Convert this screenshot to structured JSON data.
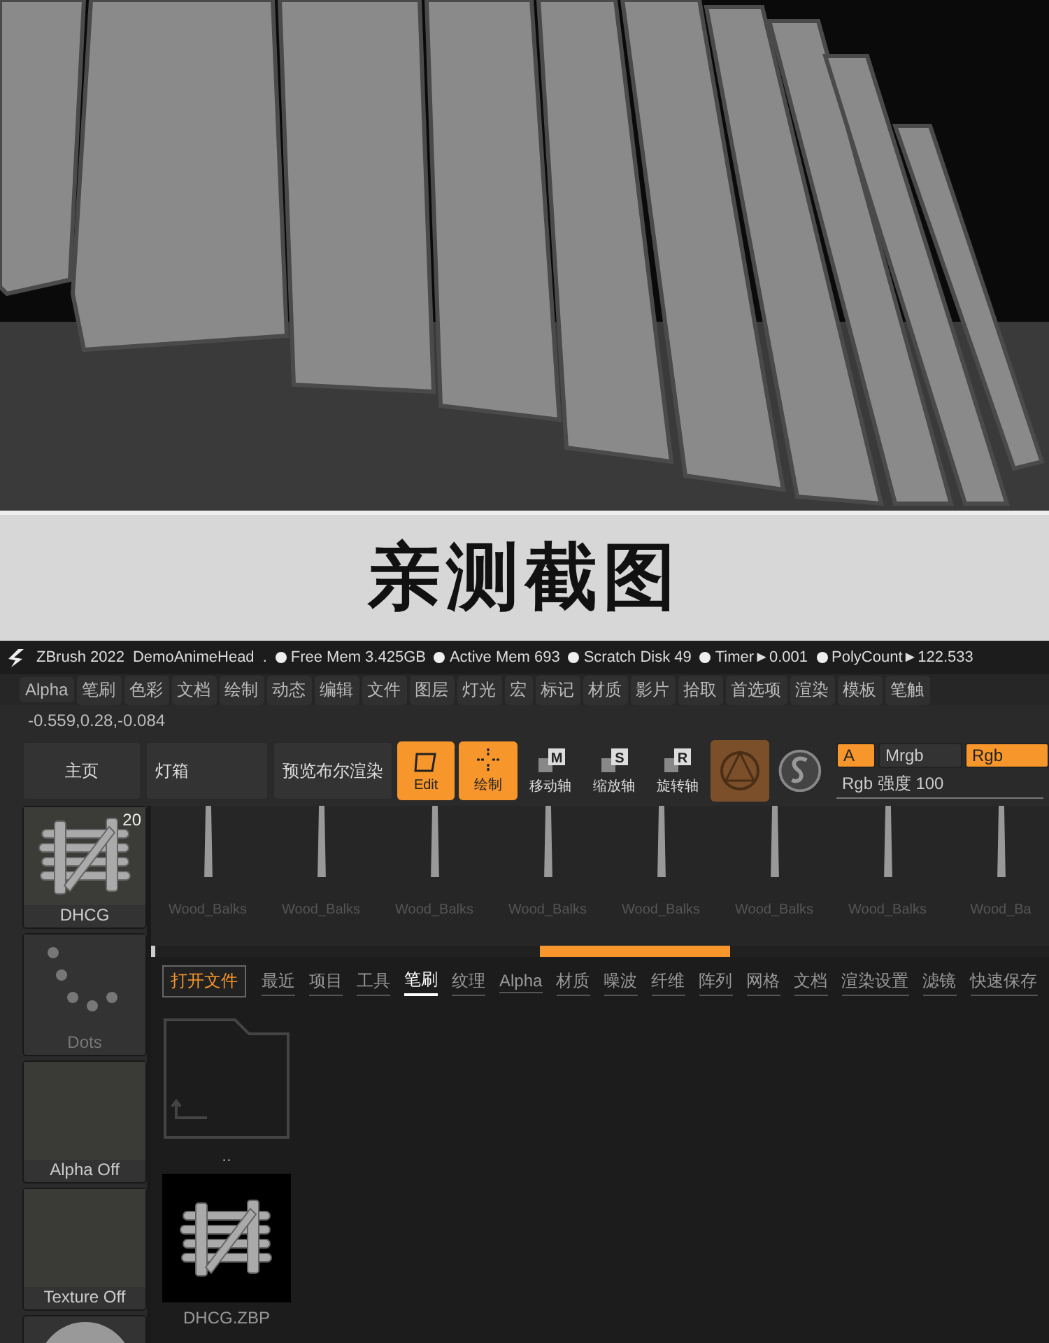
{
  "banner": {
    "title": "亲测截图"
  },
  "title_bar": {
    "app": "ZBrush 2022",
    "document": "DemoAnimeHead",
    "separator": ".",
    "stats": [
      "Free Mem 3.425GB",
      "Active Mem 693",
      "Scratch Disk 49",
      "Timer►0.001",
      "PolyCount►122.533"
    ]
  },
  "menu": [
    "Alpha",
    "笔刷",
    "色彩",
    "文档",
    "绘制",
    "动态",
    "编辑",
    "文件",
    "图层",
    "灯光",
    "宏",
    "标记",
    "材质",
    "影片",
    "拾取",
    "首选项",
    "渲染",
    "模板",
    "笔触"
  ],
  "coordinates": "-0.559,0.28,-0.084",
  "toolbar": [
    {
      "kind": "text",
      "label": "主页"
    },
    {
      "kind": "text",
      "label": "灯箱"
    },
    {
      "kind": "text",
      "label": "预览布尔渲染"
    },
    {
      "kind": "toggle",
      "label": "Edit",
      "on": true
    },
    {
      "kind": "toggle",
      "label": "绘制",
      "on": true
    },
    {
      "kind": "axis",
      "key": "M",
      "label": "移动轴"
    },
    {
      "kind": "axis",
      "key": "S",
      "label": "缩放轴"
    },
    {
      "kind": "axis",
      "key": "R",
      "label": "旋转轴"
    }
  ],
  "channels": [
    {
      "label": "A",
      "on": true
    },
    {
      "label": "Mrgb",
      "on": false
    },
    {
      "label": "Rgb",
      "on": true
    }
  ],
  "rgb_intensity": "Rgb 强度 100",
  "palette": [
    {
      "kind": "tool",
      "label": "DHCG",
      "count": "20"
    },
    {
      "kind": "stroke",
      "label": "Dots"
    },
    {
      "kind": "blank",
      "label": "Alpha Off"
    },
    {
      "kind": "blank",
      "label": "Texture Off"
    },
    {
      "kind": "material"
    }
  ],
  "lightbox": [
    "Wood_Balks",
    "Wood_Balks",
    "Wood_Balks",
    "Wood_Balks",
    "Wood_Balks",
    "Wood_Balks",
    "Wood_Balks",
    "Wood_Ba"
  ],
  "open_button": "打开文件",
  "tabs": [
    {
      "label": "最近",
      "selected": false
    },
    {
      "label": "项目",
      "selected": false
    },
    {
      "label": "工具",
      "selected": false
    },
    {
      "label": "笔刷",
      "selected": true
    },
    {
      "label": "纹理",
      "selected": false
    },
    {
      "label": "Alpha",
      "selected": false
    },
    {
      "label": "材质",
      "selected": false
    },
    {
      "label": "噪波",
      "selected": false
    },
    {
      "label": "纤维",
      "selected": false
    },
    {
      "label": "阵列",
      "selected": false
    },
    {
      "label": "网格",
      "selected": false
    },
    {
      "label": "文档",
      "selected": false
    },
    {
      "label": "渲染设置",
      "selected": false
    },
    {
      "label": "滤镜",
      "selected": false
    },
    {
      "label": "快速保存",
      "selected": false
    }
  ],
  "files": [
    {
      "kind": "folder",
      "label": ".."
    },
    {
      "kind": "model",
      "label": "DHCG.ZBP"
    }
  ]
}
